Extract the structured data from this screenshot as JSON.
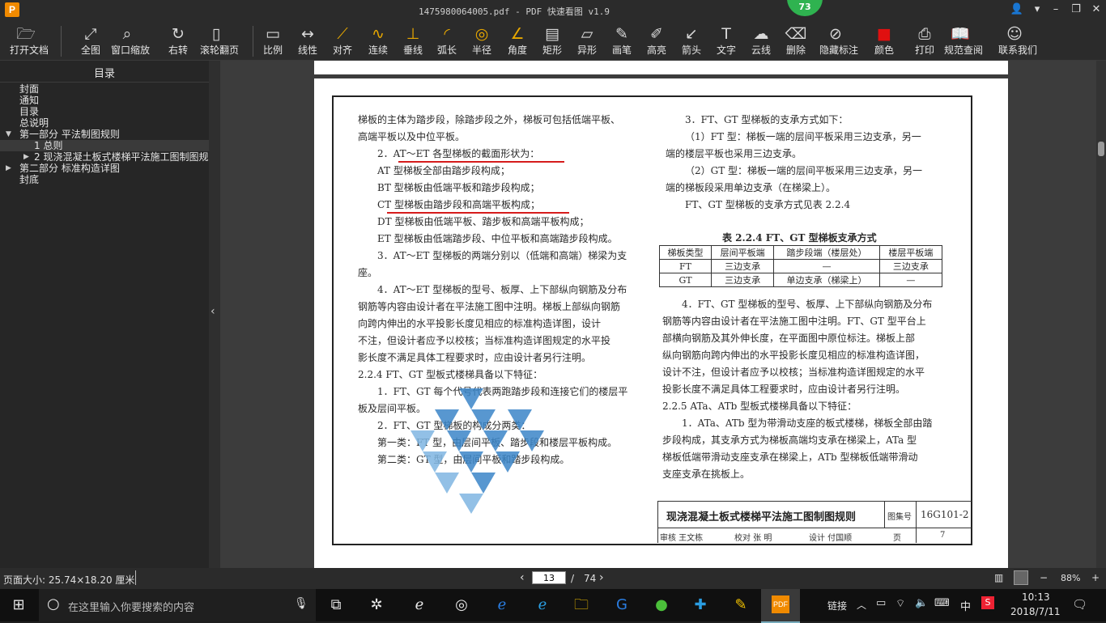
{
  "window": {
    "title": "1475980064005.pdf - PDF 快速看图 v1.9",
    "app_icon": "P",
    "badge": "73"
  },
  "toolbar": [
    {
      "label": "打开文档",
      "icon": "folder-icon",
      "glyph": "🗁"
    },
    {
      "label": "全图",
      "icon": "fullview-icon",
      "glyph": "⤢"
    },
    {
      "label": "窗口缩放",
      "icon": "zoom-icon",
      "glyph": "⌕"
    },
    {
      "label": "右转",
      "icon": "rotate-icon",
      "glyph": "↻"
    },
    {
      "label": "滚轮翻页",
      "icon": "mouse-icon",
      "glyph": "▯"
    },
    {
      "label": "比例",
      "icon": "scale-icon",
      "glyph": "▭"
    },
    {
      "label": "线性",
      "icon": "linear-icon",
      "glyph": "↔"
    },
    {
      "label": "对齐",
      "icon": "align-icon",
      "glyph": "⟋"
    },
    {
      "label": "连续",
      "icon": "continuous-icon",
      "glyph": "∿"
    },
    {
      "label": "垂线",
      "icon": "perpendicular-icon",
      "glyph": "⊥"
    },
    {
      "label": "弧长",
      "icon": "arc-icon",
      "glyph": "◜"
    },
    {
      "label": "半径",
      "icon": "radius-icon",
      "glyph": "◎"
    },
    {
      "label": "角度",
      "icon": "angle-icon",
      "glyph": "∠"
    },
    {
      "label": "矩形",
      "icon": "rectangle-icon",
      "glyph": "▤"
    },
    {
      "label": "异形",
      "icon": "polygon-icon",
      "glyph": "▱"
    },
    {
      "label": "画笔",
      "icon": "pen-icon",
      "glyph": "✎"
    },
    {
      "label": "高亮",
      "icon": "highlight-icon",
      "glyph": "✐"
    },
    {
      "label": "箭头",
      "icon": "arrow-icon",
      "glyph": "↙"
    },
    {
      "label": "文字",
      "icon": "text-icon",
      "glyph": "T"
    },
    {
      "label": "云线",
      "icon": "cloud-icon",
      "glyph": "☁"
    },
    {
      "label": "删除",
      "icon": "eraser-icon",
      "glyph": "⌫"
    },
    {
      "label": "隐藏标注",
      "icon": "hide-icon",
      "glyph": "⊘"
    },
    {
      "label": "颜色",
      "icon": "color-icon",
      "glyph": "■"
    },
    {
      "label": "打印",
      "icon": "print-icon",
      "glyph": "⎙"
    },
    {
      "label": "规范查阅",
      "icon": "book-icon",
      "glyph": "📖"
    },
    {
      "label": "联系我们",
      "icon": "contact-icon",
      "glyph": "☺"
    }
  ],
  "sidebar": {
    "title": "目录",
    "items": [
      {
        "label": "封面",
        "level": 0
      },
      {
        "label": "通知",
        "level": 0
      },
      {
        "label": "目录",
        "level": 0
      },
      {
        "label": "总说明",
        "level": 0
      },
      {
        "label": "第一部分  平法制图规则",
        "level": 0,
        "arrow": "▼"
      },
      {
        "label": "1  总则",
        "level": 1
      },
      {
        "label": "2  现浇混凝土板式楼梯平法施工图制图规",
        "level": 1,
        "arrow": "▶"
      },
      {
        "label": "第二部分  标准构造详图",
        "level": 0,
        "arrow": "▶"
      },
      {
        "label": "封底",
        "level": 0
      }
    ]
  },
  "doc": {
    "left": [
      "梯板的主体为踏步段，除踏步段之外，梯板可包括低端平板、",
      "高端平板以及中位平板。",
      "2．AT～ET 各型梯板的截面形状为：",
      "AT 型梯板全部由踏步段构成；",
      "BT 型梯板由低端平板和踏步段构成；",
      "CT 型梯板由踏步段和高端平板构成；",
      "DT 型梯板由低端平板、踏步板和高端平板构成；",
      "ET 型梯板由低端踏步段、中位平板和高端踏步段构成。",
      "3．AT～ET 型梯板的两端分别以（低端和高端）梯梁为支",
      "座。",
      "4．AT～ET 型梯板的型号、板厚、上下部纵向钢筋及分布",
      "钢筋等内容由设计者在平法施工图中注明。梯板上部纵向钢筋",
      "向跨内伸出的水平投影长度见相应的标准构造详图，设计",
      "不注，但设计者应予以校核；当标准构造详图规定的水平投",
      "影长度不满足具体工程要求时，应由设计者另行注明。",
      "2.2.4  FT、GT 型板式楼梯具备以下特征：",
      "1．FT、GT 每个代号代表两跑踏步段和连接它们的楼层平",
      "板及层间平板。",
      "2．FT、GT 型梯板的构成分两类：",
      "第一类：FT 型，由层间平板、踏步段和楼层平板构成。",
      "第二类：GT 型，由层间平板和踏步段构成。"
    ],
    "right_top": [
      "3．FT、GT 型梯板的支承方式如下：",
      "（1）FT 型：梯板一端的层间平板采用三边支承，另一",
      "端的楼层平板也采用三边支承。",
      "（2）GT 型：梯板一端的层间平板采用三边支承，另一",
      "端的梯板段采用单边支承（在梯梁上）。",
      "FT、GT 型梯板的支承方式见表 2.2.4"
    ],
    "table_title": "表 2.2.4  FT、GT 型梯板支承方式",
    "table": [
      [
        "梯板类型",
        "层间平板端",
        "踏步段端（楼层处）",
        "楼层平板端"
      ],
      [
        "FT",
        "三边支承",
        "—",
        "三边支承"
      ],
      [
        "GT",
        "三边支承",
        "单边支承（梯梁上）",
        "—"
      ]
    ],
    "right_bottom": [
      "4．FT、GT 型梯板的型号、板厚、上下部纵向钢筋及分布",
      "钢筋等内容由设计者在平法施工图中注明。FT、GT 型平台上",
      "部横向钢筋及其外伸长度，在平面图中原位标注。梯板上部",
      "纵向钢筋向跨内伸出的水平投影长度见相应的标准构造详图，",
      "设计不注，但设计者应予以校核；当标准构造详图规定的水平",
      "投影长度不满足具体工程要求时，应由设计者另行注明。",
      "2.2.5  ATa、ATb 型板式楼梯具备以下特征：",
      "1．ATa、ATb 型为带滑动支座的板式楼梯，梯板全部由踏",
      "步段构成，其支承方式为梯板高端均支承在梯梁上，ATa 型",
      "梯板低端带滑动支座支承在梯梁上，ATb 型梯板低端带滑动",
      "支座支承在挑板上。"
    ],
    "title_block": {
      "title": "现浇混凝土板式楼梯平法施工图制图规则",
      "atlas_label": "图集号",
      "atlas_no": "16G101-2",
      "review": "审核 王文栋",
      "check": "校对 张  明",
      "design": "设计 付国顺",
      "page_label": "页",
      "page_no": "7"
    }
  },
  "status": {
    "page_size": "页面大小: 25.74×18.20 厘米",
    "current_page": "13",
    "separator": "/",
    "total_pages": "74",
    "zoom": "88%",
    "minus": "−",
    "plus": "+"
  },
  "taskbar": {
    "search_placeholder": "在这里输入你要搜索的内容",
    "link_label": "链接",
    "ime": "中",
    "time": "10:13",
    "date": "2018/7/11"
  },
  "colors": {
    "accent_red": "#d61c1c",
    "badge_green": "#2fb350",
    "app_orange": "#f08a00"
  }
}
